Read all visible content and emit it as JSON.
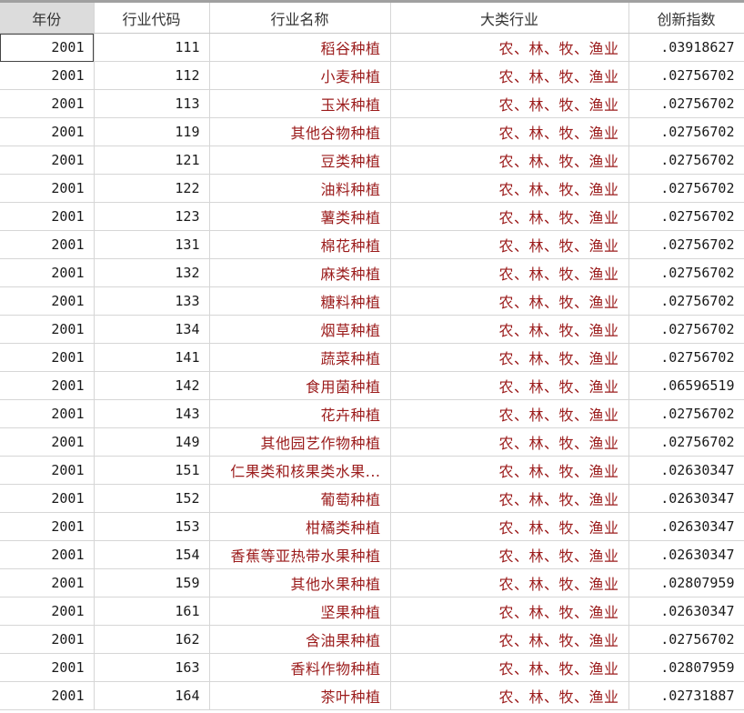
{
  "columns": [
    "年份",
    "行业代码",
    "行业名称",
    "大类行业",
    "创新指数"
  ],
  "rows": [
    [
      "2001",
      "111",
      "稻谷种植",
      "农、林、牧、渔业",
      ".03918627"
    ],
    [
      "2001",
      "112",
      "小麦种植",
      "农、林、牧、渔业",
      ".02756702"
    ],
    [
      "2001",
      "113",
      "玉米种植",
      "农、林、牧、渔业",
      ".02756702"
    ],
    [
      "2001",
      "119",
      "其他谷物种植",
      "农、林、牧、渔业",
      ".02756702"
    ],
    [
      "2001",
      "121",
      "豆类种植",
      "农、林、牧、渔业",
      ".02756702"
    ],
    [
      "2001",
      "122",
      "油料种植",
      "农、林、牧、渔业",
      ".02756702"
    ],
    [
      "2001",
      "123",
      "薯类种植",
      "农、林、牧、渔业",
      ".02756702"
    ],
    [
      "2001",
      "131",
      "棉花种植",
      "农、林、牧、渔业",
      ".02756702"
    ],
    [
      "2001",
      "132",
      "麻类种植",
      "农、林、牧、渔业",
      ".02756702"
    ],
    [
      "2001",
      "133",
      "糖料种植",
      "农、林、牧、渔业",
      ".02756702"
    ],
    [
      "2001",
      "134",
      "烟草种植",
      "农、林、牧、渔业",
      ".02756702"
    ],
    [
      "2001",
      "141",
      "蔬菜种植",
      "农、林、牧、渔业",
      ".02756702"
    ],
    [
      "2001",
      "142",
      "食用菌种植",
      "农、林、牧、渔业",
      ".06596519"
    ],
    [
      "2001",
      "143",
      "花卉种植",
      "农、林、牧、渔业",
      ".02756702"
    ],
    [
      "2001",
      "149",
      "其他园艺作物种植",
      "农、林、牧、渔业",
      ".02756702"
    ],
    [
      "2001",
      "151",
      "仁果类和核果类水果...",
      "农、林、牧、渔业",
      ".02630347"
    ],
    [
      "2001",
      "152",
      "葡萄种植",
      "农、林、牧、渔业",
      ".02630347"
    ],
    [
      "2001",
      "153",
      "柑橘类种植",
      "农、林、牧、渔业",
      ".02630347"
    ],
    [
      "2001",
      "154",
      "香蕉等亚热带水果种植",
      "农、林、牧、渔业",
      ".02630347"
    ],
    [
      "2001",
      "159",
      "其他水果种植",
      "农、林、牧、渔业",
      ".02807959"
    ],
    [
      "2001",
      "161",
      "坚果种植",
      "农、林、牧、渔业",
      ".02630347"
    ],
    [
      "2001",
      "162",
      "含油果种植",
      "农、林、牧、渔业",
      ".02756702"
    ],
    [
      "2001",
      "163",
      "香料作物种植",
      "农、林、牧、渔业",
      ".02807959"
    ],
    [
      "2001",
      "164",
      "茶叶种植",
      "农、林、牧、渔业",
      ".02731887"
    ]
  ]
}
